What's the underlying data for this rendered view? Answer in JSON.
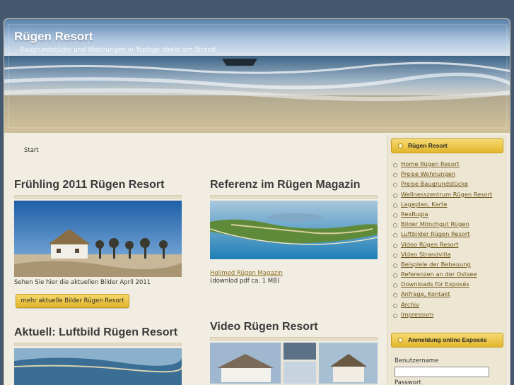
{
  "header": {
    "site_title": "Rügen Resort",
    "tagline": "Baugrundstücke und Wohnungen in Toplage direkt am Strand"
  },
  "breadcrumb": "Start",
  "posts": [
    {
      "title": "Frühling 2011 Rügen Resort",
      "text": "Sehen Sie hier die aktuellen Bilder April 2011",
      "button": "mehr aktuelle Bilder Rügen Resort"
    },
    {
      "title": "Referenz im Rügen Magazin",
      "link": "Holimed Rügen Magazin",
      "text": "(downlod pdf ca. 1 MB)"
    },
    {
      "title": "Aktuell: Luftbild Rügen Resort"
    },
    {
      "title": "Video Rügen Resort"
    }
  ],
  "sidebar": {
    "menu_title": "Rügen Resort",
    "menu": [
      "Home Rügen Resort",
      "Preise Wohnungen",
      "Preise Baugrundstücke",
      "Wellnesszentrum Rügen Resort",
      "Lageplan, Karte",
      "RexRugia",
      "Bilder Mönchgut Rügen",
      "Luftbilder Rügen Resort",
      "Video Rügen Resort",
      "Video Strandvilla",
      "Beispiele der Bebauung",
      "Referenzen an der Ostsee",
      "Downloads für Exposés",
      "Anfrage, Kontakt",
      "Archiv",
      "Impressum"
    ],
    "login_title": "Anmeldung online Exposés",
    "username_label": "Benutzername",
    "password_label": "Passwort"
  }
}
